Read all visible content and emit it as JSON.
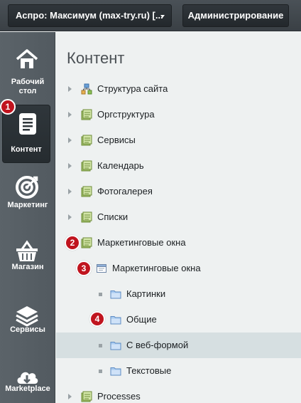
{
  "topbar": {
    "site_selector": "Аспро: Максимум (max-try.ru) [...",
    "admin_button": "Администрирование"
  },
  "leftmenu": {
    "items": [
      {
        "label": "Рабочий стол",
        "icon": "home-icon"
      },
      {
        "label": "Контент",
        "icon": "document-icon",
        "active": true,
        "badge": "1"
      },
      {
        "label": "Маркетинг",
        "icon": "target-icon"
      },
      {
        "label": "Магазин",
        "icon": "basket-icon"
      },
      {
        "label": "Сервисы",
        "icon": "layers-icon"
      },
      {
        "label": "Marketplace",
        "icon": "cloud-download-icon"
      }
    ]
  },
  "content": {
    "title": "Контент",
    "tree": [
      {
        "label": "Структура сайта",
        "icon": "site-structure-icon"
      },
      {
        "label": "Оргструктура",
        "icon": "iblock-icon"
      },
      {
        "label": "Сервисы",
        "icon": "iblock-icon"
      },
      {
        "label": "Календарь",
        "icon": "iblock-icon"
      },
      {
        "label": "Фотогалерея",
        "icon": "iblock-icon"
      },
      {
        "label": "Списки",
        "icon": "iblock-icon"
      },
      {
        "label": "Маркетинговые окна",
        "icon": "iblock-icon",
        "badge": "2"
      },
      {
        "label": "Маркетинговые окна",
        "icon": "window-icon",
        "badge": "3"
      },
      {
        "label": "Картинки",
        "icon": "folder-icon"
      },
      {
        "label": "Общие",
        "icon": "folder-icon",
        "badge": "4"
      },
      {
        "label": "С веб-формой",
        "icon": "folder-icon",
        "selected": true
      },
      {
        "label": "Текстовые",
        "icon": "folder-icon"
      },
      {
        "label": "Processes",
        "icon": "iblock-icon"
      }
    ]
  },
  "colors": {
    "badge": "#c0141e",
    "sidebar": "#5b6369",
    "content_bg": "#eef1f1",
    "selected_row": "#d6dfe1"
  }
}
